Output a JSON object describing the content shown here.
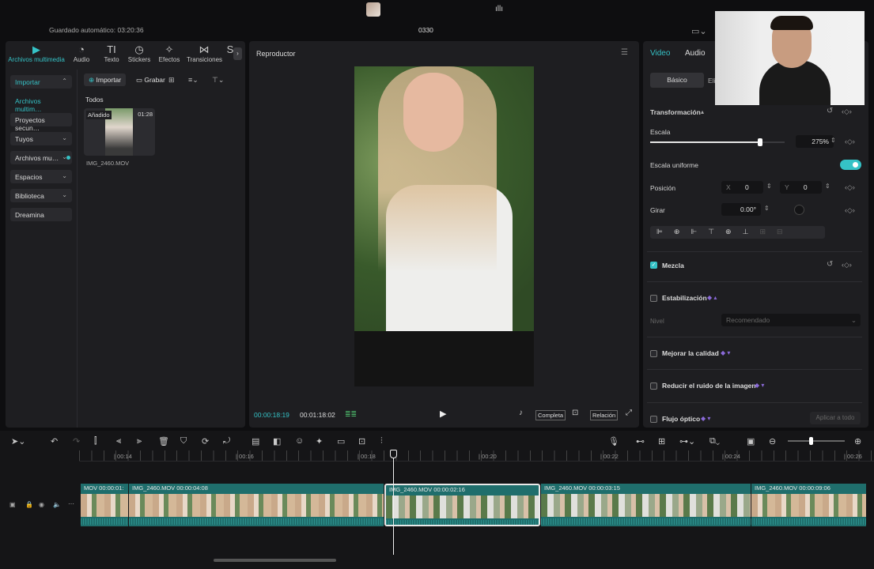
{
  "topbar": {
    "autosave": "Guardado automático: 03:20:36",
    "project": "0330"
  },
  "media_tabs": [
    {
      "icon": "media-icon",
      "glyph": "▶",
      "label": "Archivos multimedia",
      "active": true
    },
    {
      "icon": "audio-icon",
      "glyph": "◔",
      "label": "Audio"
    },
    {
      "icon": "text-icon",
      "glyph": "TI",
      "label": "Texto"
    },
    {
      "icon": "sticker-icon",
      "glyph": "◷",
      "label": "Stickers"
    },
    {
      "icon": "effects-icon",
      "glyph": "✧",
      "label": "Efectos"
    },
    {
      "icon": "transitions-icon",
      "glyph": "⋈",
      "label": "Transiciones"
    },
    {
      "icon": "more-icon",
      "glyph": "S",
      "label": ""
    }
  ],
  "sidebar": {
    "items": [
      {
        "label": "Importar",
        "chev": "⌃",
        "highlight": true
      },
      {
        "label": "Archivos multim…",
        "active": true
      },
      {
        "label": "Proyectos secun…"
      },
      {
        "label": "Tuyos",
        "chev": "⌄"
      },
      {
        "label": "Archivos mu…",
        "chev": "⌄",
        "dot": true
      },
      {
        "label": "Espacios",
        "chev": "⌄"
      },
      {
        "label": "Biblioteca",
        "chev": "⌄"
      },
      {
        "label": "Dreamina"
      }
    ]
  },
  "media_toolbar": {
    "import": "Importar",
    "record": "Grabar"
  },
  "media_section": "Todos",
  "media_item": {
    "badge": "Añadido",
    "duration": "01:28",
    "name": "IMG_2460.MOV"
  },
  "player": {
    "title": "Reproductor",
    "current_time": "00:00:18:19",
    "total_time": "00:01:18:02",
    "full": "Completa",
    "ratio": "Relación"
  },
  "inspector": {
    "tabs": [
      "Video",
      "Audio"
    ],
    "subtabs": [
      "Básico",
      "Eli"
    ],
    "transform": "Transformación",
    "scale_label": "Escala",
    "scale_value": "275%",
    "scale_fraction": 0.82,
    "uniform_label": "Escala uniforme",
    "position_label": "Posición",
    "pos_x_label": "X",
    "pos_x": "0",
    "pos_y_label": "Y",
    "pos_y": "0",
    "rotate_label": "Girar",
    "rotate_value": "0.00°",
    "blend": "Mezcla",
    "stabilize": "Estabilización",
    "level_label": "Nivel",
    "level_value": "Recomendado",
    "enhance": "Mejorar la calidad",
    "denoise": "Reducir el ruido de la imagen",
    "optical": "Flujo óptico",
    "apply_all": "Aplicar a todo"
  },
  "ruler": [
    "00:14",
    "00:16",
    "00:18",
    "00:20",
    "00:22",
    "00:24",
    "00:26"
  ],
  "clips": [
    {
      "label": "MOV  00:00:01:"
    },
    {
      "label": "IMG_2460.MOV   00:00:04:08"
    },
    {
      "label": "IMG_2460.MOV   00:00:02:16",
      "selected": true
    },
    {
      "label": "IMG_2460.MOV   00:00:03:15"
    },
    {
      "label": "IMG_2460.MOV   00:00:09:06"
    }
  ],
  "colors": {
    "accent": "#35c2c6",
    "clip": "#1f6e6c",
    "panel": "#1e1e21"
  }
}
